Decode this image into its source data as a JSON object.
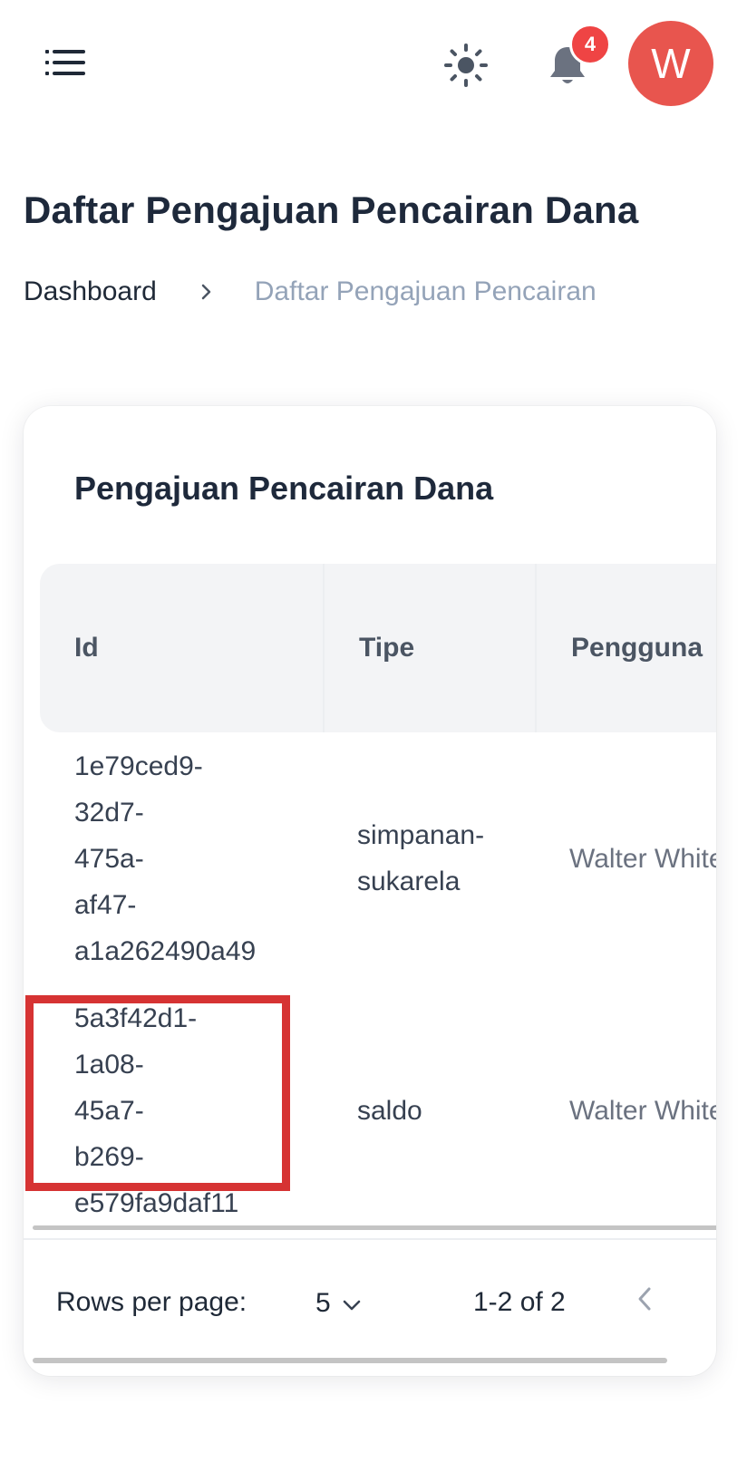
{
  "header": {
    "notification_count": "4",
    "avatar_initial": "W",
    "icons": {
      "menu": "menu-icon",
      "theme": "sun-icon",
      "notifications": "bell-icon"
    },
    "colors": {
      "badge": "#ef4444",
      "avatar": "#e8554e"
    }
  },
  "page": {
    "title": "Daftar Pengajuan Pencairan Dana",
    "breadcrumb": {
      "home": "Dashboard",
      "current": "Daftar Pengajuan Pencairan"
    }
  },
  "card": {
    "title": "Pengajuan Pencairan Dana",
    "table": {
      "columns": [
        "Id",
        "Tipe",
        "Pengguna"
      ],
      "rows": [
        {
          "id": "1e79ced9-32d7-475a-af47-a1a262490a49",
          "tipe": "simpanan-sukarela",
          "pengguna": "Walter White"
        },
        {
          "id": "5a3f42d1-1a08-45a7-b269-e579fa9daf11",
          "tipe": "saldo",
          "pengguna": "Walter White"
        }
      ]
    },
    "pagination": {
      "rows_per_page_label": "Rows per page:",
      "rows_per_page_value": "5",
      "range": "1-2 of 2"
    }
  },
  "highlight_color": "#d63333"
}
